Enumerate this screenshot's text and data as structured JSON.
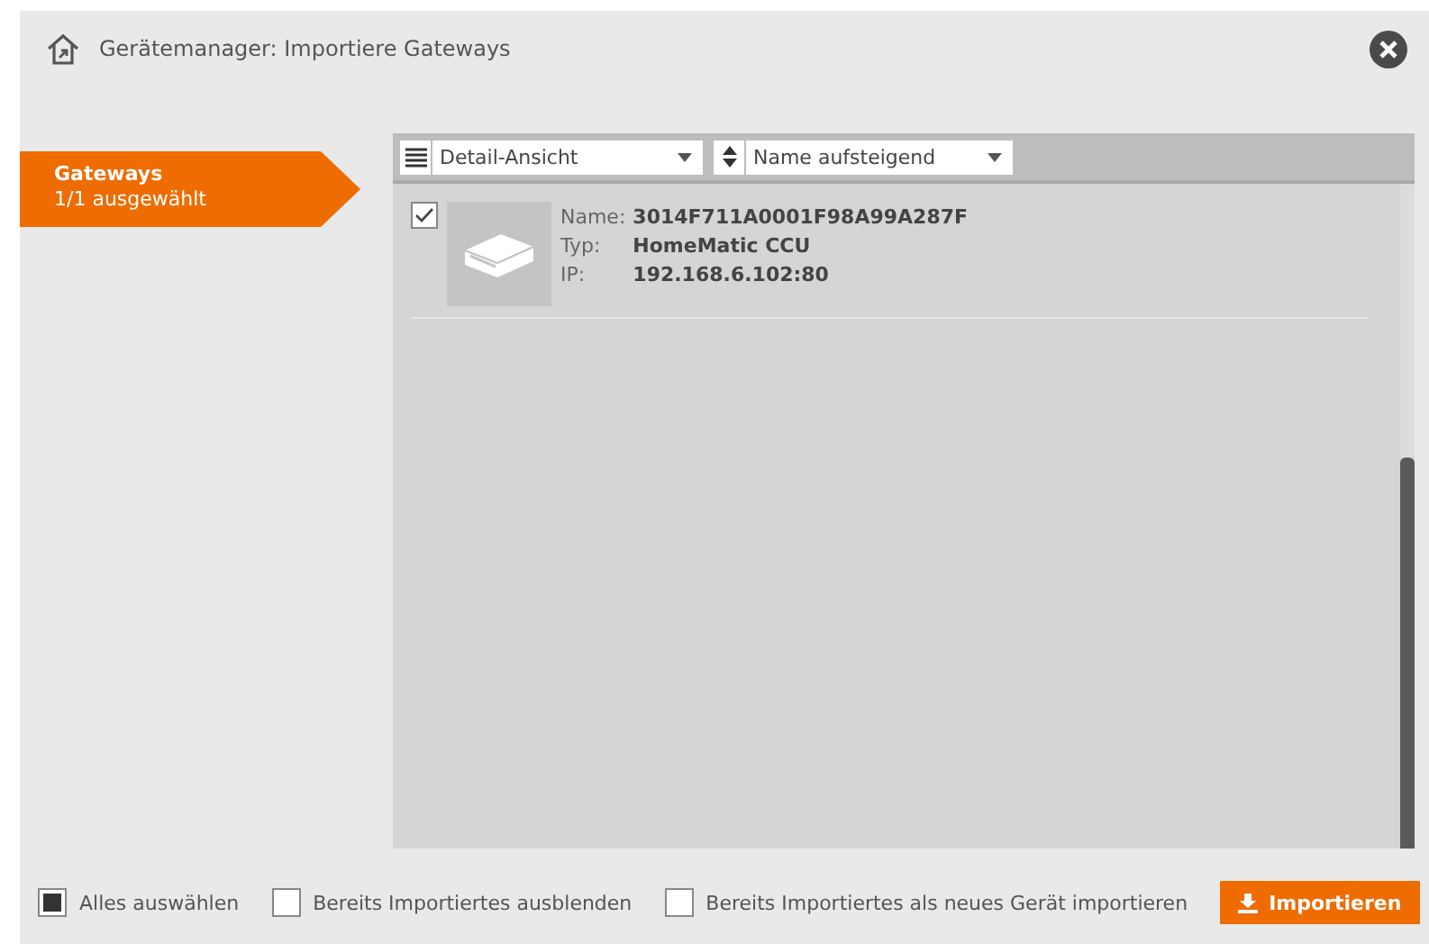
{
  "window": {
    "title": "Gerätemanager: Importiere Gateways"
  },
  "sidebar": {
    "items": [
      {
        "title": "Gateways",
        "subtitle": "1/1 ausgewählt",
        "selected": true
      }
    ]
  },
  "toolbar": {
    "view": "Detail-Ansicht",
    "sort": "Name aufsteigend"
  },
  "gateways": [
    {
      "checked": true,
      "fields": [
        {
          "label": "Name:",
          "value": "3014F711A0001F98A99A287F"
        },
        {
          "label": "Typ:",
          "value": "HomeMatic CCU"
        },
        {
          "label": "IP:",
          "value": "192.168.6.102:80"
        }
      ]
    }
  ],
  "options": [
    {
      "label": "Alles auswählen",
      "checked": true
    },
    {
      "label": "Bereits Importiertes ausblenden",
      "checked": false
    },
    {
      "label": "Bereits Importiertes als neues Gerät importieren",
      "checked": false
    }
  ],
  "import_button": "Importieren"
}
